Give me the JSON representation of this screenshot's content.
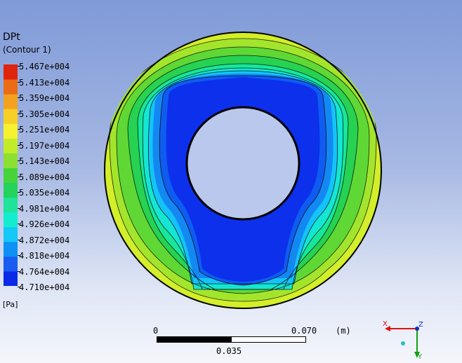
{
  "legend": {
    "title": "DPt",
    "subtitle": "(Contour 1)",
    "unit": "[Pa]",
    "ticks": [
      "5.467e+004",
      "5.413e+004",
      "5.359e+004",
      "5.305e+004",
      "5.251e+004",
      "5.197e+004",
      "5.143e+004",
      "5.089e+004",
      "5.035e+004",
      "4.981e+004",
      "4.926e+004",
      "4.872e+004",
      "4.818e+004",
      "4.764e+004",
      "4.710e+004"
    ],
    "colors": [
      "#0a2ae8",
      "#1a5cf0",
      "#0f90f5",
      "#14c8f8",
      "#14eccf",
      "#1ee39a",
      "#23d35b",
      "#46d43a",
      "#8ce032",
      "#c2ec2a",
      "#f6f22f",
      "#f6cf27",
      "#f3a21f",
      "#ec6b16",
      "#e0250e"
    ]
  },
  "scale": {
    "start": "0",
    "mid": "0.035",
    "end": "0.070",
    "unit": "(m)"
  },
  "axes": {
    "x": "X",
    "y": "Y",
    "z": "Z"
  }
}
